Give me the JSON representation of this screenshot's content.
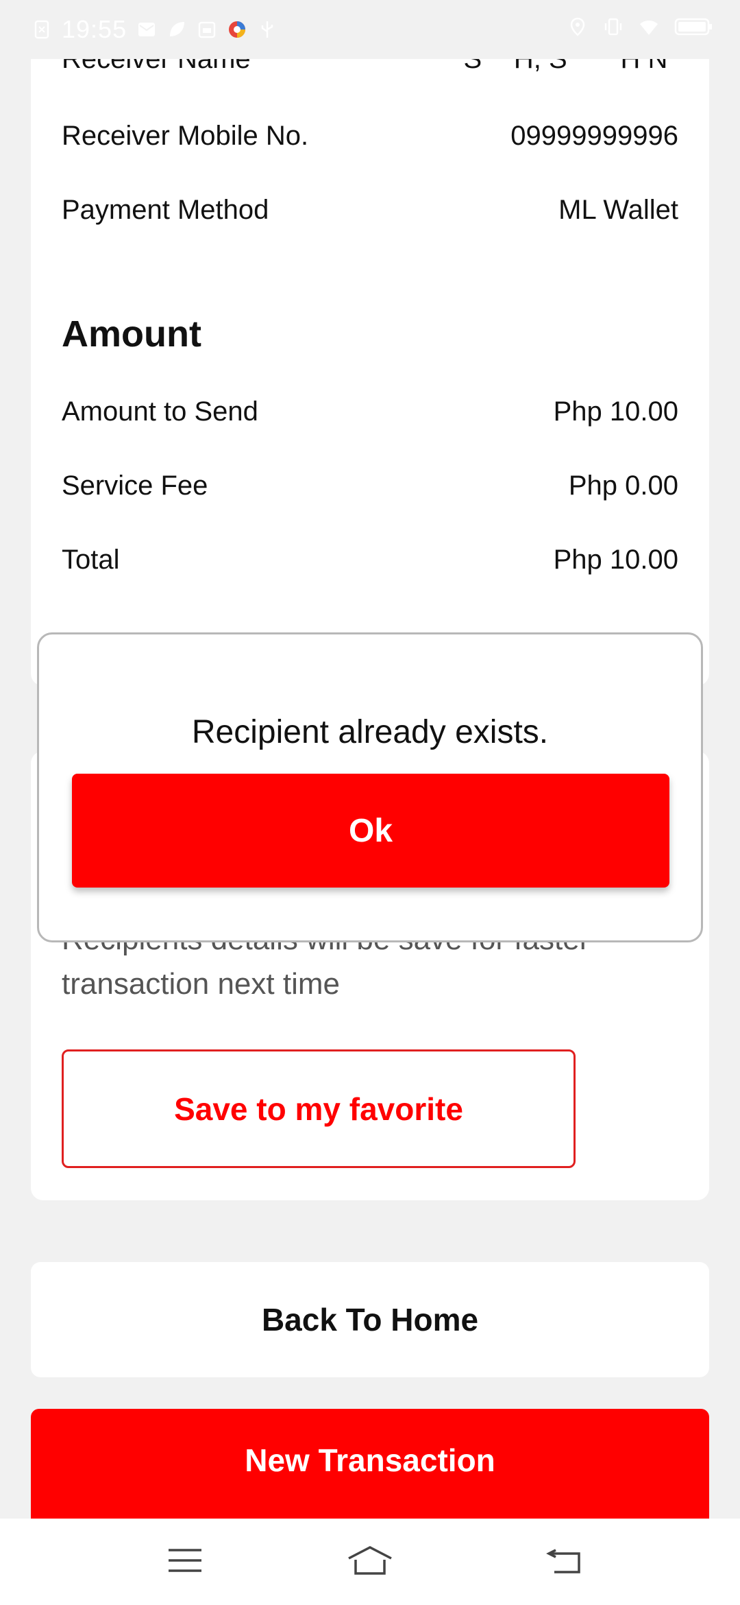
{
  "status_bar": {
    "time": "19:55"
  },
  "summary": {
    "rows": [
      {
        "label": "Receiver Name",
        "value": "S***H, S*****H N*"
      },
      {
        "label": "Receiver Mobile No.",
        "value": "09999999996"
      },
      {
        "label": "Payment Method",
        "value": "ML Wallet"
      }
    ],
    "amount_title": "Amount",
    "amount_rows": [
      {
        "label": "Amount to Send",
        "value": "Php 10.00"
      },
      {
        "label": "Service Fee",
        "value": "Php 0.00"
      },
      {
        "label": "Total",
        "value": "Php 10.00"
      }
    ]
  },
  "favorite": {
    "description_line1": "Recipients details will be save for faster",
    "description_line2": "transaction next time",
    "button_label": "Save to my favorite"
  },
  "actions": {
    "back_home": "Back To Home",
    "new_transaction": "New Transaction"
  },
  "dialog": {
    "message": "Recipient already exists.",
    "ok_label": "Ok"
  },
  "colors": {
    "accent": "#ff0000",
    "background": "#f1f1f1"
  },
  "nav": {
    "icons": [
      "menu-icon",
      "home-icon",
      "back-icon"
    ]
  }
}
